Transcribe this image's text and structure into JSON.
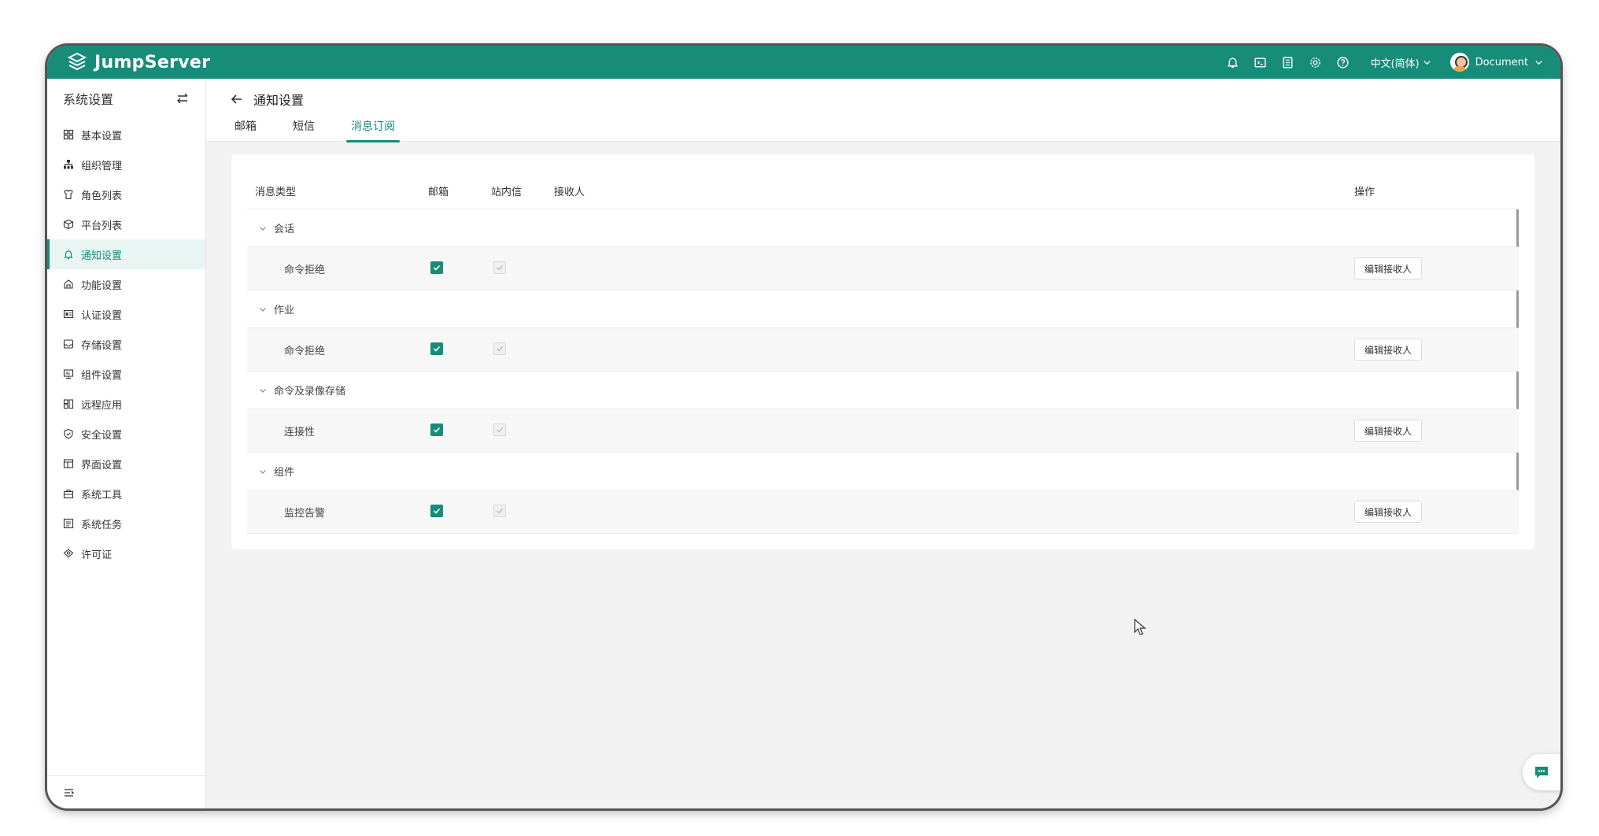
{
  "app": {
    "logo_text": "JumpServer",
    "brand_color": "#178c79"
  },
  "topbar": {
    "language": "中文(简体)",
    "user_name": "Document",
    "icons": [
      "bell-icon",
      "terminal-icon",
      "document-icon",
      "gear-icon",
      "help-icon"
    ]
  },
  "sidebar": {
    "title": "系统设置",
    "items": [
      {
        "label": "基本设置",
        "icon": "grid-icon"
      },
      {
        "label": "组织管理",
        "icon": "org-tree-icon"
      },
      {
        "label": "角色列表",
        "icon": "role-icon"
      },
      {
        "label": "平台列表",
        "icon": "cube-icon"
      },
      {
        "label": "通知设置",
        "icon": "bell-icon",
        "active": true
      },
      {
        "label": "功能设置",
        "icon": "feature-icon"
      },
      {
        "label": "认证设置",
        "icon": "id-card-icon"
      },
      {
        "label": "存储设置",
        "icon": "storage-icon"
      },
      {
        "label": "组件设置",
        "icon": "component-icon"
      },
      {
        "label": "远程应用",
        "icon": "remote-app-icon"
      },
      {
        "label": "安全设置",
        "icon": "shield-icon"
      },
      {
        "label": "界面设置",
        "icon": "interface-icon"
      },
      {
        "label": "系统工具",
        "icon": "toolbox-icon"
      },
      {
        "label": "系统任务",
        "icon": "task-icon"
      },
      {
        "label": "许可证",
        "icon": "license-icon"
      }
    ]
  },
  "page": {
    "title": "通知设置",
    "tabs": [
      {
        "label": "邮箱"
      },
      {
        "label": "短信"
      },
      {
        "label": "消息订阅",
        "active": true
      }
    ]
  },
  "table": {
    "headers": {
      "type": "消息类型",
      "mail": "邮箱",
      "site": "站内信",
      "receivers": "接收人",
      "actions": "操作"
    },
    "groups": [
      {
        "name": "会话",
        "items": [
          {
            "name": "命令拒绝",
            "mail": true,
            "site": true,
            "action": "编辑接收人"
          }
        ]
      },
      {
        "name": "作业",
        "items": [
          {
            "name": "命令拒绝",
            "mail": true,
            "site": true,
            "action": "编辑接收人"
          }
        ]
      },
      {
        "name": "命令及录像存储",
        "items": [
          {
            "name": "连接性",
            "mail": true,
            "site": true,
            "action": "编辑接收人"
          }
        ]
      },
      {
        "name": "组件",
        "items": [
          {
            "name": "监控告警",
            "mail": true,
            "site": true,
            "action": "编辑接收人"
          }
        ]
      }
    ]
  }
}
